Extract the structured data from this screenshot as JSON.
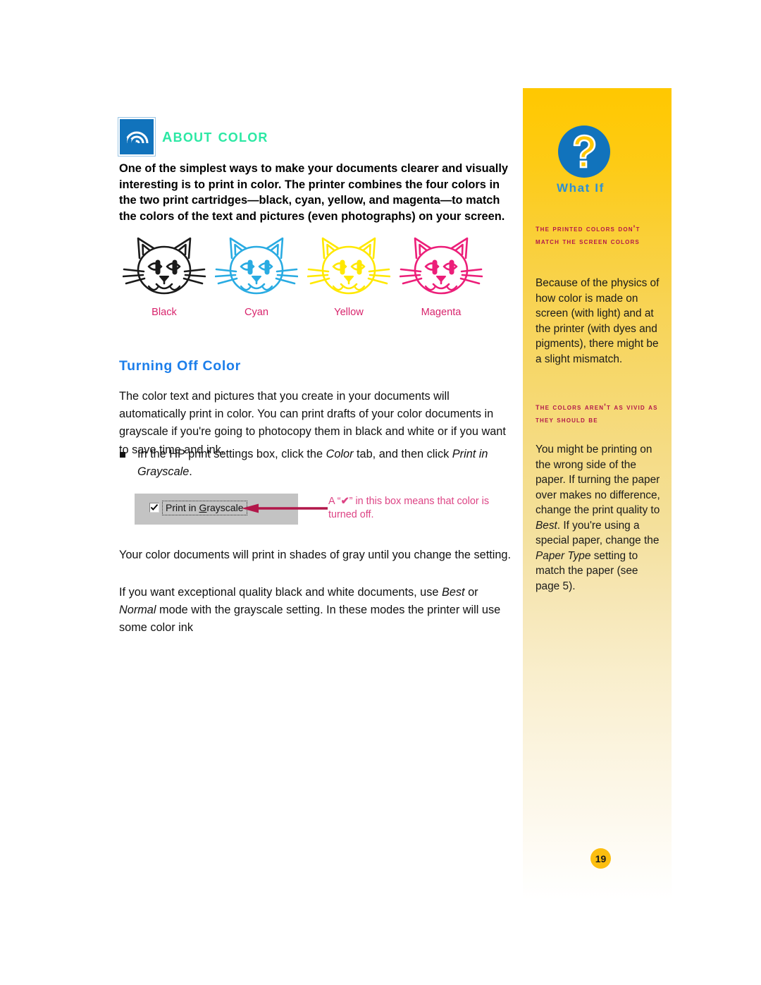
{
  "document": {
    "section_icon": "rainbow-icon",
    "section_title": "About Color",
    "intro": "One of the simplest ways to make your documents clearer and visually interesting is to print in color. The printer combines the four colors in the two print cartridges—black, cyan, yellow, and magenta—to match the colors of the text and pictures (even photographs) on your screen.",
    "subhead": "Turning Off Color",
    "paragraph_1": "The color text and pictures that you create in your documents will automatically print in color. You can print drafts of your color documents in grayscale if you're going to photocopy them in black and white or if you want to save time and ink.",
    "bullet": {
      "before_italic_1": "In the HP print settings box, click the ",
      "italic_1": "Color",
      "between": " tab, and then click ",
      "italic_2": "Print in Grayscale",
      "after": "."
    },
    "paragraph_2": "Your color documents will print in shades of gray until you change the setting.",
    "paragraph_3": {
      "t1": "If you want exceptional quality black and white documents, use ",
      "i1": "Best",
      "t2": "  or ",
      "i2": "Normal",
      "t3": " mode with the grayscale setting. In these modes the printer will use some color ink"
    }
  },
  "cats": [
    {
      "label": "Black",
      "color": "#1A1A1A"
    },
    {
      "label": "Cyan",
      "color": "#29ABE2"
    },
    {
      "label": "Yellow",
      "color": "#FFE800"
    },
    {
      "label": "Magenta",
      "color": "#EC1E79"
    }
  ],
  "figure": {
    "checkbox_checked": true,
    "checkbox_label_pre": "Print in ",
    "checkbox_label_accel": "G",
    "checkbox_label_post": "rayscale",
    "callout_pre": "A “",
    "callout_check": "✔",
    "callout_post": "” in this box means that color is turned off."
  },
  "sidebar": {
    "badge_icon": "question-mark-icon",
    "badge_label": "What If",
    "entries": [
      {
        "heading": "The printed colors don't match the screen colors",
        "body": "Because of the physics of how color is made on screen (with light) and at the printer (with dyes and pigments), there might be a slight mismatch."
      },
      {
        "heading": "The colors aren't as vivid as they should be",
        "body_t1": "You might be printing on the wrong side of the paper. If turning the paper over makes no difference, change the print quality to ",
        "body_i1": "Best",
        "body_t2": ". If you're using a special paper, change the ",
        "body_i2": "Paper Type",
        "body_t3": " setting to match the paper (see page 5)."
      }
    ],
    "page_number": "19"
  },
  "colors": {
    "accent_blue": "#1173BC",
    "heading_green": "#2CE8A4",
    "subhead_blue": "#1C7EEA",
    "sidebar_heading": "#B2174A",
    "callout_pink": "#DD4485",
    "arrow_crimson": "#B2174A",
    "page_badge": "#FCBE10"
  }
}
